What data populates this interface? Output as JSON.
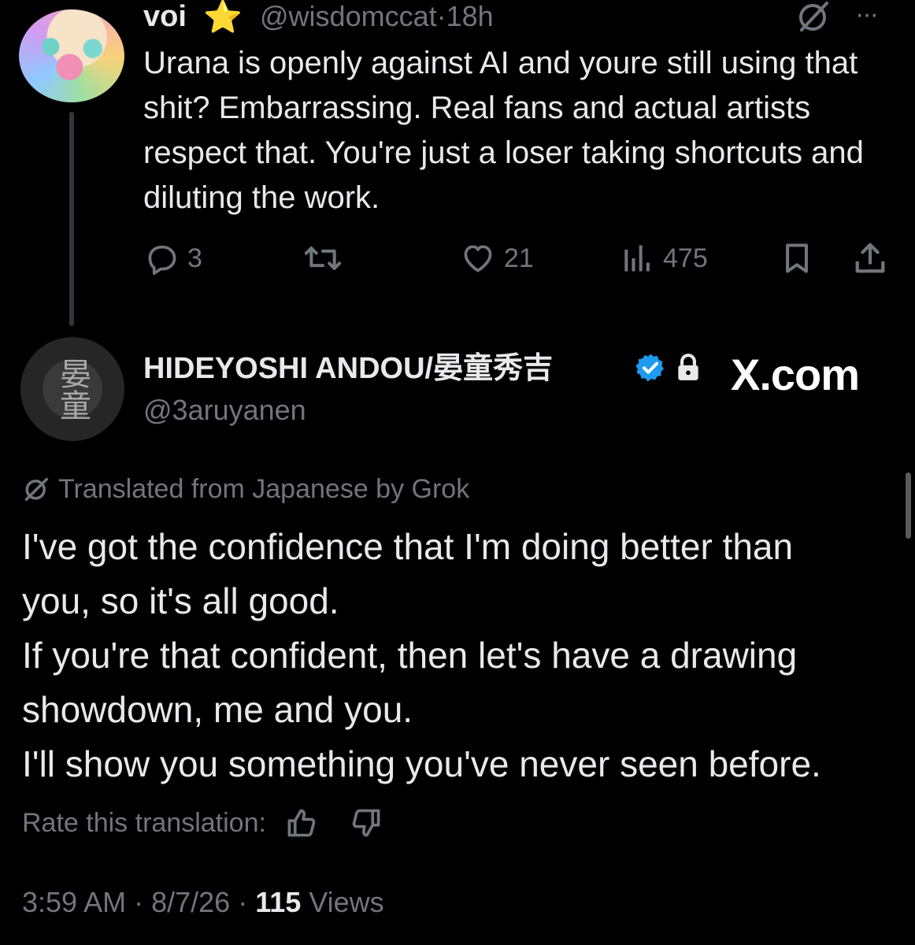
{
  "reply": {
    "name": "voi",
    "badge_emoji": "⭐",
    "handle": "@wisdomccat",
    "separator": "·",
    "time": "18h",
    "more": "···",
    "text": "Urana is openly against AI and youre still using that shit? Embarrassing. Real fans and actual artists respect that. You're just a loser taking shortcuts and diluting the work.",
    "replies": "3",
    "likes": "21",
    "views": "475"
  },
  "post": {
    "name": "HIDEYOSHI ANDOU/晏童秀吉",
    "handle": "@3aruyanen",
    "avatar_text": "晏童",
    "watermark": "X.com",
    "translated_label": "Translated from Japanese by Grok",
    "lines": [
      "I've got the confidence that I'm doing better than",
      "you, so it's all good.",
      "If you're that confident, then let's have a drawing",
      "showdown, me and you.",
      "I'll show you something you've never seen before."
    ],
    "rate_label": "Rate this translation:",
    "time": "3:59 AM",
    "sep1": " · ",
    "date": "8/7/26",
    "sep2": " · ",
    "views_count": "115",
    "views_label": " Views"
  },
  "colors": {
    "background": "#000000",
    "text_primary": "#e7e9ea",
    "text_secondary": "#71767b",
    "verified_blue": "#1d9bf0",
    "thread_line": "#333639"
  },
  "icons": [
    "grok-icon",
    "more-icon",
    "reply-icon",
    "retweet-icon",
    "like-icon",
    "views-icon",
    "bookmark-icon",
    "share-icon",
    "verified-icon",
    "lock-icon",
    "thumbs-up-icon",
    "thumbs-down-icon"
  ]
}
